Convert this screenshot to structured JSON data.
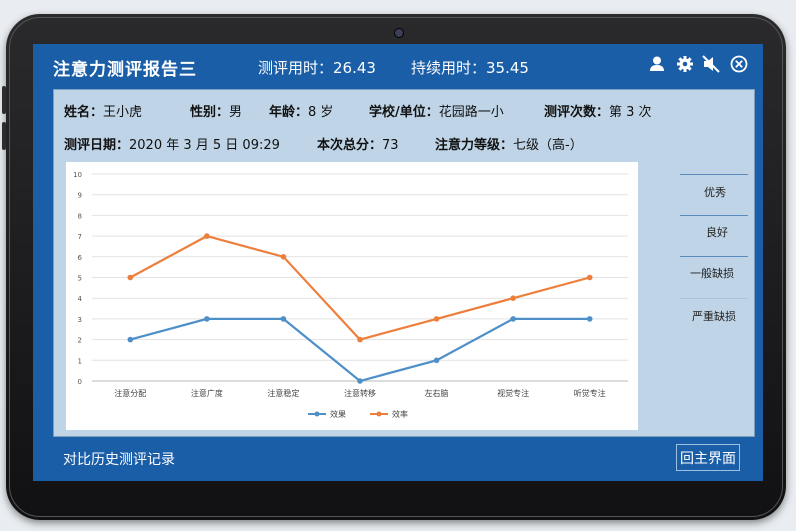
{
  "header": {
    "title": "注意力测评报告三",
    "assess_time": "测评用时：26.43",
    "sustain_time": "持续用时：35.45"
  },
  "header_icons": [
    "user-icon",
    "gear-icon",
    "mute-icon",
    "close-icon"
  ],
  "info": {
    "name_label": "姓名：",
    "name_value": "王小虎",
    "gender_label": "性别：",
    "gender_value": "男",
    "age_label": "年龄：",
    "age_value": "8 岁",
    "school_label": "学校/单位：",
    "school_value": "花园路一小",
    "count_label": "测评次数：",
    "count_value": "第 3 次",
    "date_label": "测评日期：",
    "date_value": "2020 年 3 月 5 日  09:29",
    "score_label": "本次总分：",
    "score_value": "73",
    "level_label": "注意力等级：",
    "level_value": "七级（高-）"
  },
  "levels": [
    "优秀",
    "良好",
    "一般缺损",
    "严重缺损"
  ],
  "chart_data": {
    "type": "line",
    "categories": [
      "注意分配",
      "注意广度",
      "注意稳定",
      "注意转移",
      "左右脑",
      "视觉专注",
      "听觉专注"
    ],
    "series": [
      {
        "name": "效果",
        "values": [
          2,
          3,
          3,
          0,
          1,
          3,
          3
        ],
        "color": "#4e8fc8"
      },
      {
        "name": "效率",
        "values": [
          5,
          7,
          6,
          2,
          3,
          4,
          5
        ],
        "color": "#ec7f3b"
      }
    ],
    "ylim": [
      0,
      10
    ],
    "yticks": [
      "0",
      "1",
      "2",
      "3",
      "4",
      "5",
      "6",
      "7",
      "8",
      "9",
      "10"
    ],
    "grid": true,
    "legend": "bottom"
  },
  "footer": {
    "history_link": "对比历史测评记录",
    "back_button": "回主界面"
  },
  "colors": {
    "screen_bg": "#1a5ea8",
    "panel_bg": "#bfd5e7",
    "accent": "#ec7f3b"
  }
}
